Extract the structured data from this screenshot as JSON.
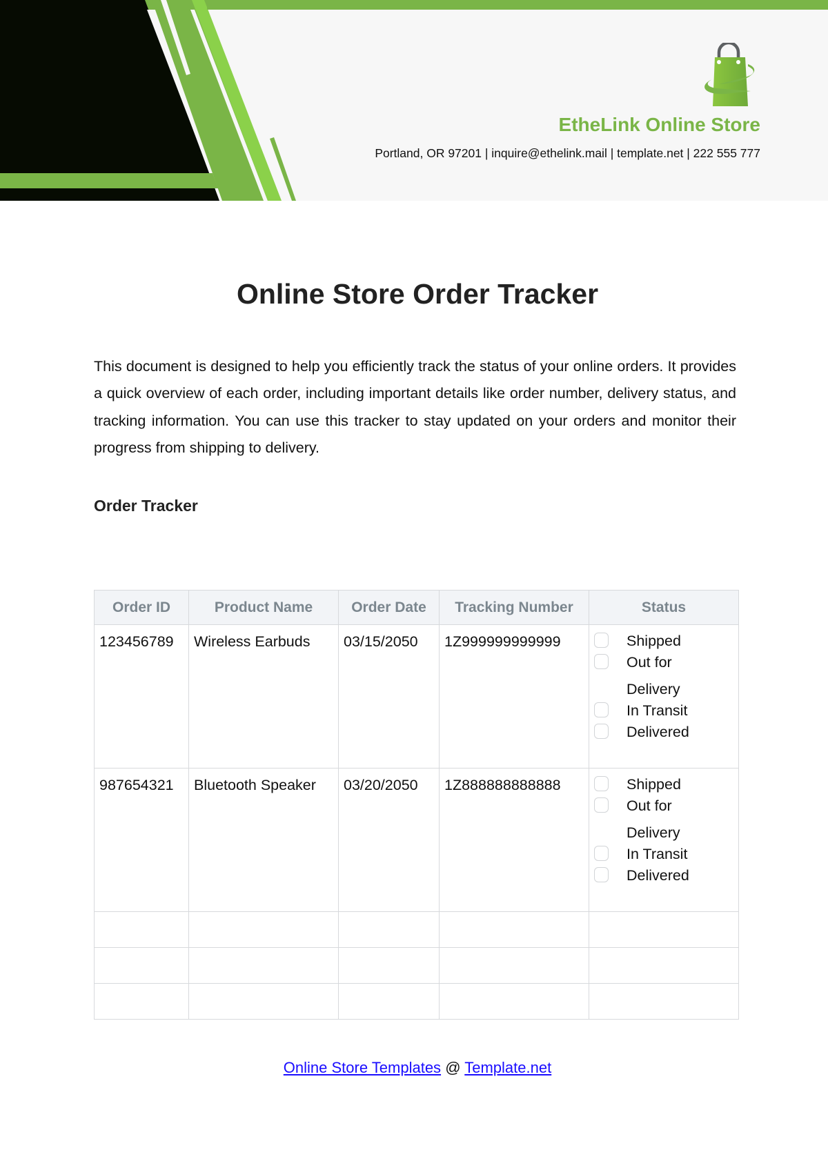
{
  "header": {
    "store_name": "EtheLink Online Store",
    "contact_line": "Portland, OR 97201 | inquire@ethelink.mail | template.net | 222 555 777",
    "logo_icon": "shopping-bag-icon",
    "colors": {
      "accent_green": "#7ab547",
      "bright_green": "#8bd14a",
      "dark": "#060b02",
      "header_bg": "#f7f7f7"
    }
  },
  "document": {
    "title": "Online Store Order Tracker",
    "intro": "This document is designed to help you efficiently track the status of your online orders. It provides a quick overview of each order, including important details like order number, delivery status, and tracking information. You can use this tracker to stay updated on your orders and monitor their progress from shipping to delivery.",
    "section_heading": "Order Tracker"
  },
  "table": {
    "columns": [
      "Order ID",
      "Product Name",
      "Order Date",
      "Tracking Number",
      "Status"
    ],
    "rows": [
      {
        "order_id": "123456789",
        "product_name": "Wireless Earbuds",
        "order_date": "03/15/2050",
        "tracking_number": "1Z999999999999",
        "status_options": [
          {
            "label": "Shipped",
            "checked": false
          },
          {
            "label": "Out for Delivery",
            "checked": false
          },
          {
            "label": "In Transit",
            "checked": false
          },
          {
            "label": "Delivered",
            "checked": false
          }
        ]
      },
      {
        "order_id": "987654321",
        "product_name": "Bluetooth Speaker",
        "order_date": "03/20/2050",
        "tracking_number": "1Z888888888888",
        "status_options": [
          {
            "label": "Shipped",
            "checked": false
          },
          {
            "label": "Out for Delivery",
            "checked": false
          },
          {
            "label": "In Transit",
            "checked": false
          },
          {
            "label": "Delivered",
            "checked": false
          }
        ]
      }
    ],
    "empty_rows": 3
  },
  "footer": {
    "link1": "Online Store Templates",
    "separator": "@",
    "link2": "Template.net"
  }
}
